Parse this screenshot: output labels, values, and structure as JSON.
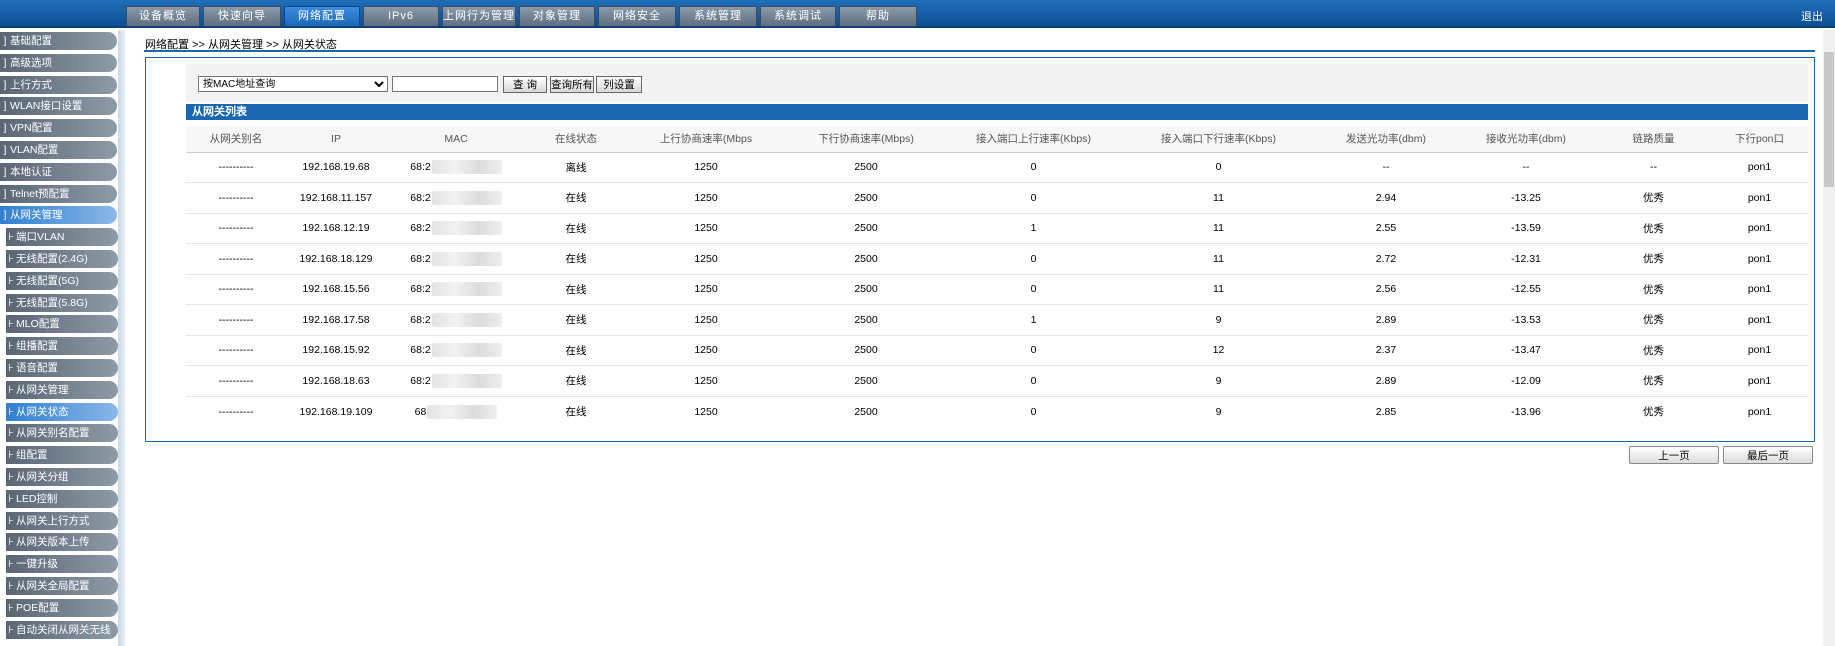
{
  "topnav": {
    "items": [
      {
        "label": "设备概览"
      },
      {
        "label": "快速向导"
      },
      {
        "label": "网络配置",
        "active": true
      },
      {
        "label": "IPv6"
      },
      {
        "label": "上网行为管理"
      },
      {
        "label": "对象管理"
      },
      {
        "label": "网络安全"
      },
      {
        "label": "系统管理"
      },
      {
        "label": "系统调试"
      },
      {
        "label": "帮助"
      }
    ],
    "logout": "退出"
  },
  "sidebar": {
    "items": [
      {
        "label": "基础配置",
        "level": 1,
        "prefix": "]"
      },
      {
        "label": "高级选项",
        "level": 1,
        "prefix": "]"
      },
      {
        "label": "上行方式",
        "level": 1,
        "prefix": "]"
      },
      {
        "label": "WLAN接口设置",
        "level": 1,
        "prefix": "]"
      },
      {
        "label": "VPN配置",
        "level": 1,
        "prefix": "]"
      },
      {
        "label": "VLAN配置",
        "level": 1,
        "prefix": "]"
      },
      {
        "label": "本地认证",
        "level": 1,
        "prefix": "]"
      },
      {
        "label": "Telnet预配置",
        "level": 1,
        "prefix": "]"
      },
      {
        "label": "从网关管理",
        "level": 1,
        "prefix": "]",
        "active": true
      },
      {
        "label": "端口VLAN",
        "level": 2,
        "prefix": "⊦"
      },
      {
        "label": "无线配置(2.4G)",
        "level": 2,
        "prefix": "⊦"
      },
      {
        "label": "无线配置(5G)",
        "level": 2,
        "prefix": "⊦"
      },
      {
        "label": "无线配置(5.8G)",
        "level": 2,
        "prefix": "⊦"
      },
      {
        "label": "MLO配置",
        "level": 2,
        "prefix": "⊦"
      },
      {
        "label": "组播配置",
        "level": 2,
        "prefix": "⊦"
      },
      {
        "label": "语音配置",
        "level": 2,
        "prefix": "⊦"
      },
      {
        "label": "从网关管理",
        "level": 2,
        "prefix": "⊦"
      },
      {
        "label": "从网关状态",
        "level": 2,
        "prefix": "⊦",
        "active": true
      },
      {
        "label": "从网关别名配置",
        "level": 2,
        "prefix": "⊦"
      },
      {
        "label": "组配置",
        "level": 2,
        "prefix": "⊦"
      },
      {
        "label": "从网关分组",
        "level": 2,
        "prefix": "⊦"
      },
      {
        "label": "LED控制",
        "level": 2,
        "prefix": "⊦"
      },
      {
        "label": "从网关上行方式",
        "level": 2,
        "prefix": "⊦"
      },
      {
        "label": "从网关版本上传",
        "level": 2,
        "prefix": "⊦"
      },
      {
        "label": "一键升级",
        "level": 2,
        "prefix": "⊦"
      },
      {
        "label": "从网关全局配置",
        "level": 2,
        "prefix": "⊦"
      },
      {
        "label": "POE配置",
        "level": 2,
        "prefix": "⊦"
      },
      {
        "label": "自动关闭从网关无线",
        "level": 2,
        "prefix": "⊦"
      }
    ]
  },
  "breadcrumb": "网络配置 >> 从网关管理 >> 从网关状态",
  "search": {
    "select_value": "按MAC地址查询",
    "input_value": "",
    "query_label": "查 询",
    "query_all_label": "查询所有",
    "column_settings_label": "列设置"
  },
  "list_title": "从网关列表",
  "table": {
    "headers": [
      "从网关别名",
      "IP",
      "MAC",
      "在线状态",
      "上行协商速率(Mbps",
      "下行协商速率(Mbps)",
      "接入端口上行速率(Kbps)",
      "接入端口下行速率(Kbps)",
      "发送光功率(dbm)",
      "接收光功率(dbm)",
      "链路质量",
      "下行pon口"
    ],
    "rows": [
      [
        "----------",
        "192.168.19.68",
        "68:2",
        "离线",
        "1250",
        "2500",
        "0",
        "0",
        "--",
        "--",
        "--",
        "pon1"
      ],
      [
        "----------",
        "192.168.11.157",
        "68:2",
        "在线",
        "1250",
        "2500",
        "0",
        "11",
        "2.94",
        "-13.25",
        "优秀",
        "pon1"
      ],
      [
        "----------",
        "192.168.12.19",
        "68:2",
        "在线",
        "1250",
        "2500",
        "1",
        "11",
        "2.55",
        "-13.59",
        "优秀",
        "pon1"
      ],
      [
        "----------",
        "192.168.18.129",
        "68:2",
        "在线",
        "1250",
        "2500",
        "0",
        "11",
        "2.72",
        "-12.31",
        "优秀",
        "pon1"
      ],
      [
        "----------",
        "192.168.15.56",
        "68:2",
        "在线",
        "1250",
        "2500",
        "0",
        "11",
        "2.56",
        "-12.55",
        "优秀",
        "pon1"
      ],
      [
        "----------",
        "192.168.17.58",
        "68:2",
        "在线",
        "1250",
        "2500",
        "1",
        "9",
        "2.89",
        "-13.53",
        "优秀",
        "pon1"
      ],
      [
        "----------",
        "192.168.15.92",
        "68:2",
        "在线",
        "1250",
        "2500",
        "0",
        "12",
        "2.37",
        "-13.47",
        "优秀",
        "pon1"
      ],
      [
        "----------",
        "192.168.18.63",
        "68:2",
        "在线",
        "1250",
        "2500",
        "0",
        "9",
        "2.89",
        "-12.09",
        "优秀",
        "pon1"
      ],
      [
        "----------",
        "192.168.19.109",
        "68",
        "在线",
        "1250",
        "2500",
        "0",
        "9",
        "2.85",
        "-13.96",
        "优秀",
        "pon1"
      ]
    ]
  },
  "pagination": {
    "prev_label": "上一页",
    "last_label": "最后一页"
  },
  "colors": {
    "brand_blue": "#1a66b0",
    "active_tab": "#2f7fd0"
  }
}
